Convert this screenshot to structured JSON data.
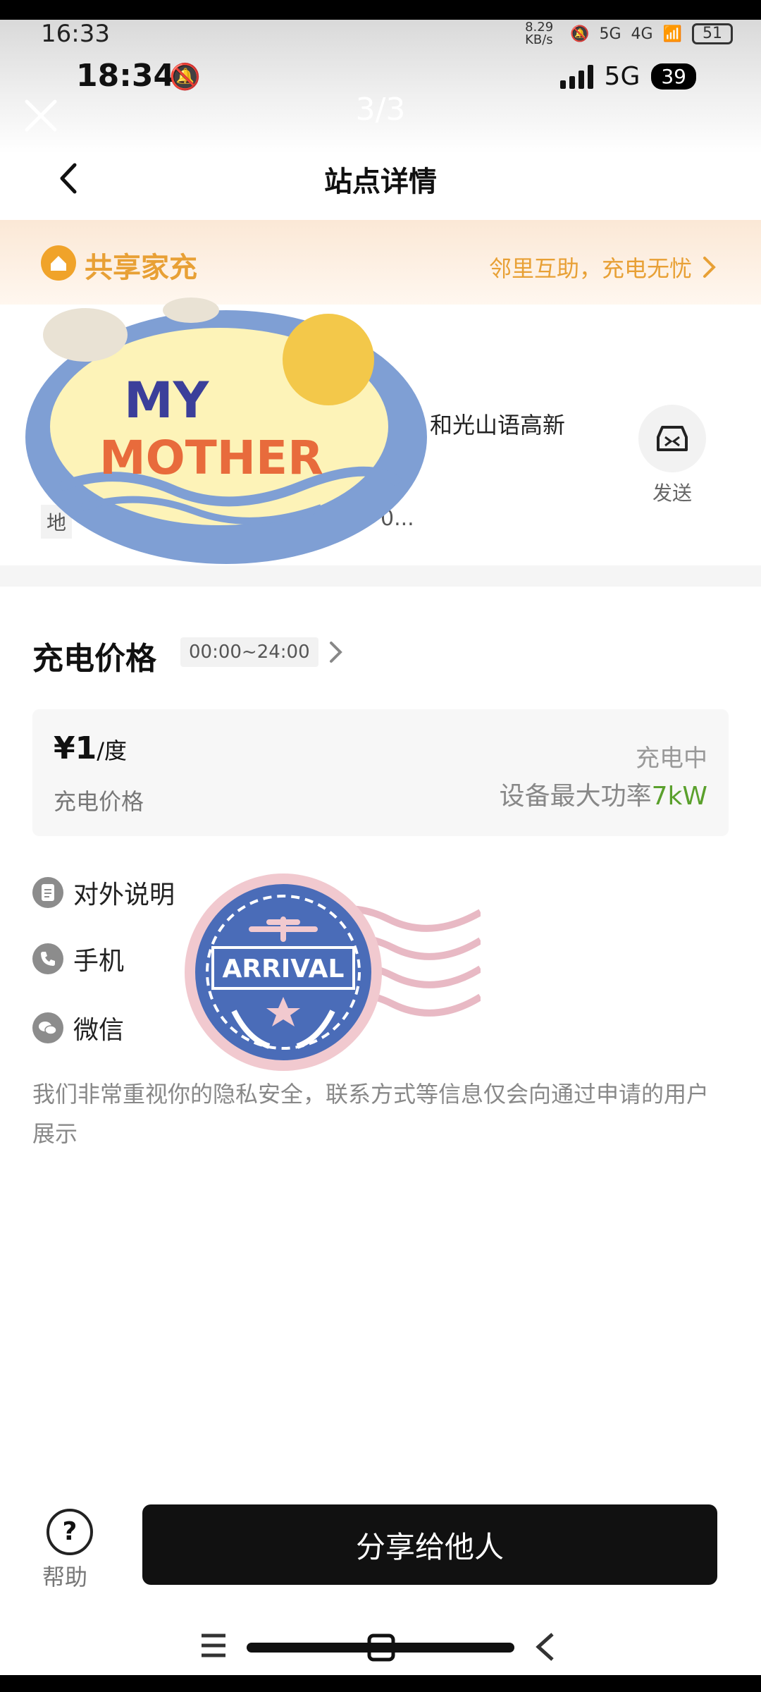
{
  "system_status": {
    "time": "16:33",
    "speed": "8.29 KB/s",
    "net1": "5G",
    "net2": "4G",
    "battery": "51"
  },
  "app_status": {
    "time": "18:34",
    "network": "5G",
    "battery": "39"
  },
  "viewer": {
    "counter": "3/3"
  },
  "header": {
    "title": "站点详情"
  },
  "banner": {
    "title": "共享家充",
    "subtitle": "邻里互助，充电无忧"
  },
  "station": {
    "address_fragment": "和光山语高新",
    "address_tag": "地",
    "address_tail": "0...",
    "send_label": "发送"
  },
  "price": {
    "heading": "充电价格",
    "time_range": "00:00~24:00",
    "value": "¥1",
    "unit": "/度",
    "label": "充电价格",
    "status": "充电中",
    "power_prefix": "设备最大功率",
    "power_value": "7kW"
  },
  "contacts": {
    "items": [
      "对外说明",
      "手机",
      "微信"
    ],
    "privacy_note": "我们非常重视你的隐私安全，联系方式等信息仅会向通过申请的用户展示"
  },
  "stickers": {
    "mother": [
      "MY",
      "MOTHER"
    ],
    "stamp": "ARRIVAL"
  },
  "footer": {
    "help_label": "帮助",
    "share_label": "分享给他人",
    "help_icon_glyph": "?"
  },
  "colors": {
    "accent_orange": "#e8a035",
    "power_green": "#5aa02c",
    "button_dark": "#111111"
  }
}
